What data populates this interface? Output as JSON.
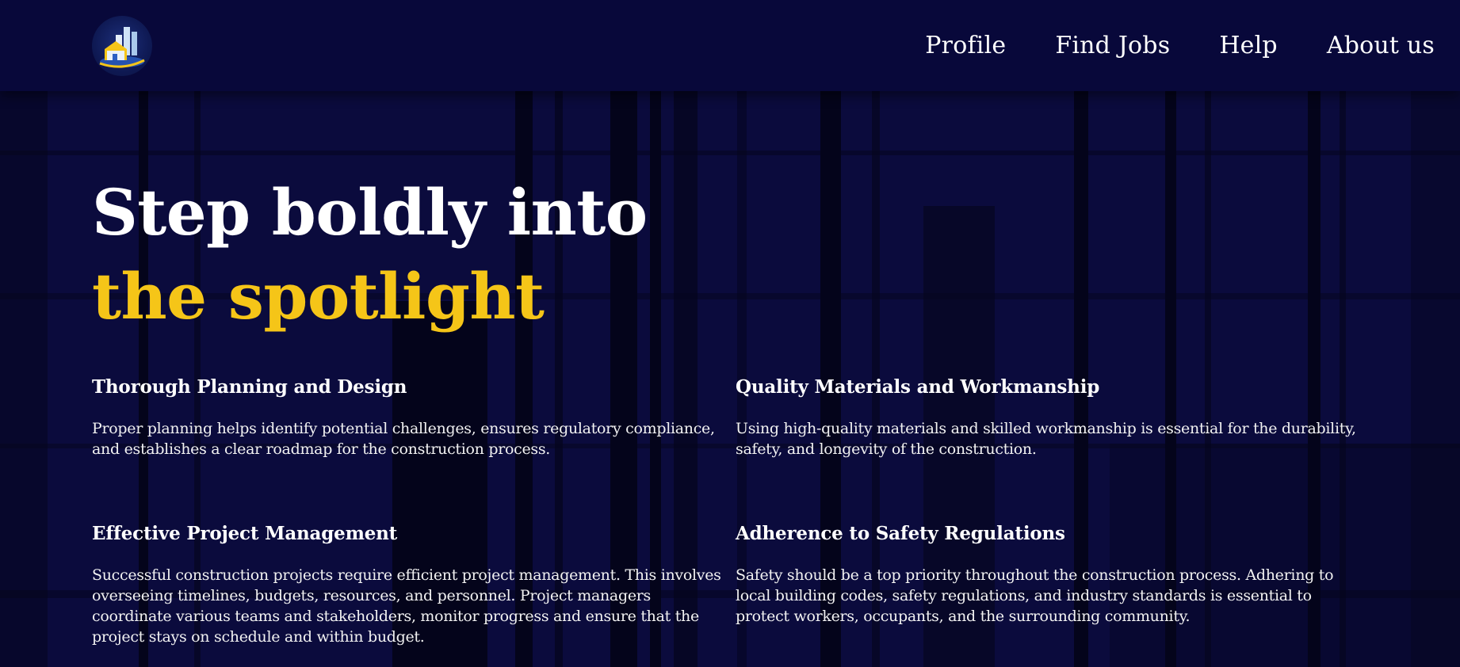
{
  "nav": {
    "links": [
      "Profile",
      "Find Jobs",
      "Help",
      "About us"
    ],
    "logo_icon": "city-buildings-logo"
  },
  "hero": {
    "line1": "Step boldly into",
    "line2": "the spotlight"
  },
  "features": [
    {
      "title": "Thorough Planning and Design",
      "text": "Proper planning helps identify potential challenges, ensures regulatory compliance, and establishes a clear roadmap for the construction process."
    },
    {
      "title": "Quality Materials and Workmanship",
      "text": "Using high-quality materials and skilled workmanship is essential for the durability, safety, and longevity of the construction."
    },
    {
      "title": "Effective Project Management",
      "text": "Successful construction projects require efficient project management. This involves overseeing timelines, budgets, resources, and personnel. Project managers coordinate various teams and stakeholders, monitor progress and ensure that the project stays on schedule and within budget."
    },
    {
      "title": "Adherence to Safety Regulations",
      "text": "Safety should be a top priority throughout the construction process. Adhering to local building codes, safety regulations, and industry standards is essential to protect workers, occupants, and the surrounding community."
    }
  ],
  "colors": {
    "background": "#0b0b3d",
    "navbar": "#08083a",
    "accent": "#f5c518",
    "text": "#ffffff"
  }
}
